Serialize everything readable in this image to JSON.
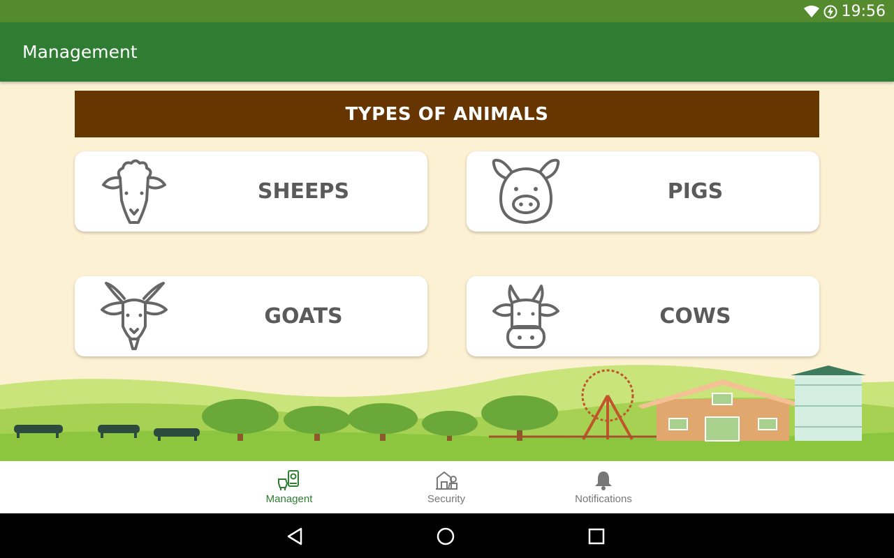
{
  "status_bar": {
    "time": "19:56",
    "icons": [
      "wifi-icon",
      "battery-charging-icon"
    ]
  },
  "app_bar": {
    "title": "Management"
  },
  "section": {
    "title": "TYPES OF ANIMALS"
  },
  "cards": [
    {
      "label": "SHEEPS",
      "icon": "sheep-icon"
    },
    {
      "label": "PIGS",
      "icon": "pig-icon"
    },
    {
      "label": "GOATS",
      "icon": "goat-icon"
    },
    {
      "label": "COWS",
      "icon": "cow-icon"
    }
  ],
  "bottom_nav": {
    "items": [
      {
        "label": "Managent",
        "icon": "farm-management-icon",
        "active": true
      },
      {
        "label": "Security",
        "icon": "security-farm-icon",
        "active": false
      },
      {
        "label": "Notifications",
        "icon": "bell-icon",
        "active": false
      }
    ]
  },
  "system_nav": [
    "back-icon",
    "home-icon",
    "recents-icon"
  ],
  "colors": {
    "status_bar": "#558b2f",
    "app_bar": "#2e7d32",
    "background": "#fdf1d3",
    "section_header": "#663500",
    "card_text": "#5a5a5a",
    "active_nav": "#2e7d32",
    "inactive_nav": "#777777"
  }
}
